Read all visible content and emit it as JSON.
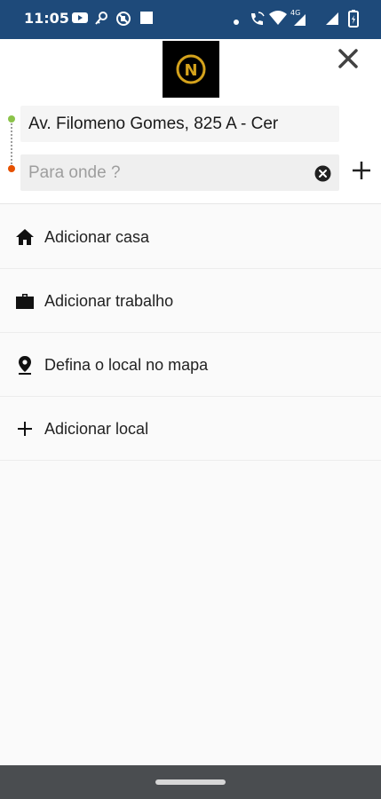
{
  "status_bar": {
    "time": "11:05",
    "icons_left": [
      "youtube-icon",
      "key-icon",
      "no-sim-icon",
      "stop-icon"
    ],
    "icons_right": [
      "dot-icon",
      "wifi-calling-icon",
      "wifi-icon",
      "signal-4g-icon",
      "signal-icon",
      "battery-icon"
    ],
    "background": "#1e4a7a"
  },
  "header": {
    "logo_letter": "N",
    "logo_color": "#d4a21c",
    "origin_value": "Av. Filomeno Gomes, 825 A - Cer",
    "destination_placeholder": "Para onde ?",
    "destination_value": ""
  },
  "places": [
    {
      "icon": "home-icon",
      "label": "Adicionar casa"
    },
    {
      "icon": "briefcase-icon",
      "label": "Adicionar trabalho"
    },
    {
      "icon": "location-pin-icon",
      "label": "Defina o local no mapa"
    },
    {
      "icon": "plus-icon",
      "label": "Adicionar local"
    }
  ]
}
